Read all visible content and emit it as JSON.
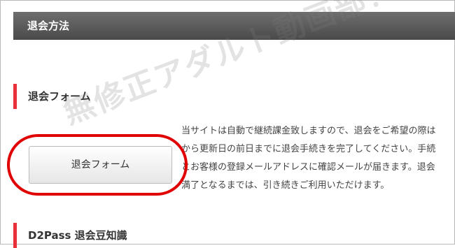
{
  "header": {
    "title": "退会方法"
  },
  "watermark": {
    "text": "無修正アダルト動画部！"
  },
  "form_section": {
    "heading": "退会フォーム",
    "button_label": "退会フォーム",
    "description_lines": [
      "当サイトは自動で継続課金致しますので、退会をご希望の際は",
      "から更新日の前日までに退会手続きを完了してください。手続",
      "とお客様の登録メールアドレスに確認メールが届きます。退会",
      "満了となるまでは、引き続きご利用いただけます。"
    ]
  },
  "d2pass_section": {
    "heading": "D2Pass 退会豆知識"
  },
  "colors": {
    "accent": "#e8303a",
    "highlight": "#e00000",
    "header_bg": "#5a5a5a"
  }
}
